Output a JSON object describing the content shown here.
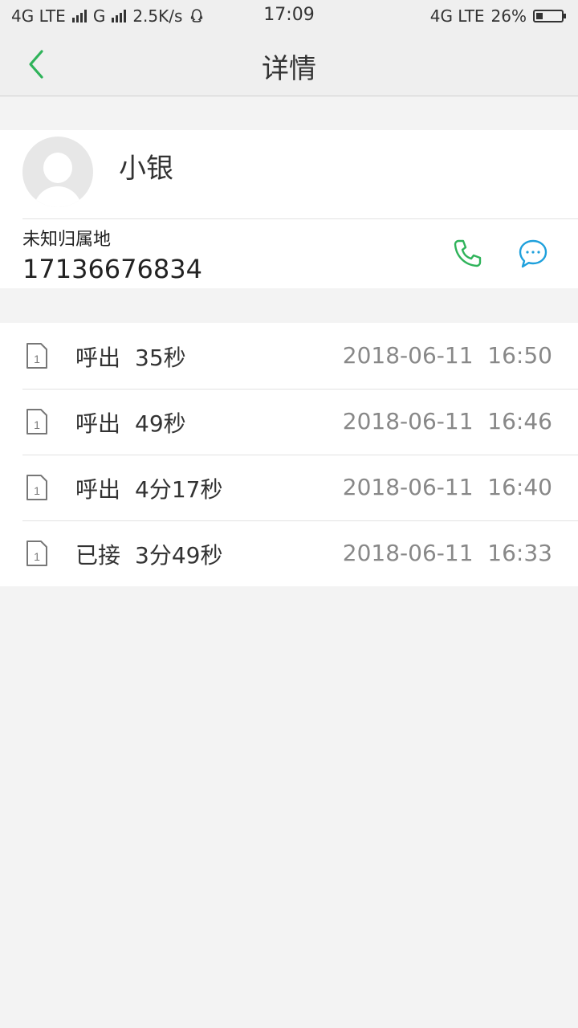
{
  "status_bar": {
    "network_left": "4G LTE",
    "network_g": "G",
    "speed": "2.5K/s",
    "time": "17:09",
    "network_right": "4G LTE",
    "battery": "26%"
  },
  "header": {
    "title": "详情"
  },
  "contact": {
    "name": "小银",
    "location": "未知归属地",
    "phone": "17136676834"
  },
  "call_log": [
    {
      "sim": "1",
      "type": "呼出",
      "duration": "35秒",
      "time": "2018-06-11  16:50"
    },
    {
      "sim": "1",
      "type": "呼出",
      "duration": "49秒",
      "time": "2018-06-11  16:46"
    },
    {
      "sim": "1",
      "type": "呼出",
      "duration": "4分17秒",
      "time": "2018-06-11  16:40"
    },
    {
      "sim": "1",
      "type": "已接",
      "duration": "3分49秒",
      "time": "2018-06-11  16:33"
    }
  ],
  "colors": {
    "accent_green": "#2fb35a",
    "accent_blue": "#1ea0dc"
  }
}
